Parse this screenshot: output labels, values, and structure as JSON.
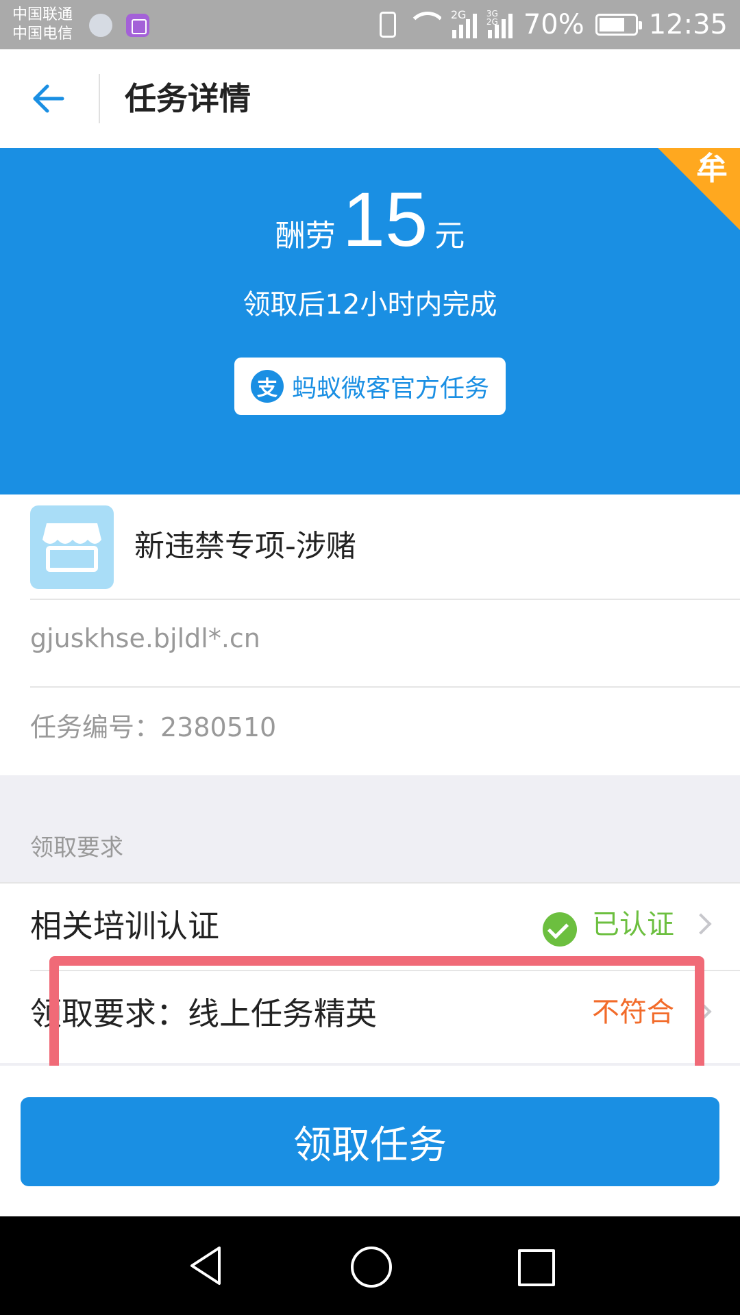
{
  "status_bar": {
    "carrier_1": "中国联通",
    "carrier_2": "中国电信",
    "signal_1_label": "2G",
    "signal_2_label": "3G 2G",
    "battery_percent": "70%",
    "battery_level": 0.7,
    "time": "12:35"
  },
  "nav": {
    "title": "任务详情"
  },
  "banner": {
    "reward_label": "酬劳",
    "reward_amount": "15",
    "reward_unit": "元",
    "deadline": "领取后12小时内完成",
    "official_tag": "蚂蚁微客官方任务",
    "alipay_glyph": "支",
    "corner_badge": "牟",
    "colors": {
      "primary": "#1a8fe3",
      "corner": "#ffa81f"
    }
  },
  "task": {
    "name": "新违禁专项-涉赌",
    "url": "gjuskhse.bjldl*.cn",
    "number": "任务编号：2380510"
  },
  "requirements": {
    "section_label": "领取要求",
    "items": [
      {
        "title": "相关培训认证",
        "status": "已认证"
      },
      {
        "title": "领取要求：线上任务精英",
        "status": "不符合"
      }
    ],
    "colors": {
      "ok": "#6cbf3f",
      "fail": "#f26b2a",
      "highlight": "#f06a77"
    }
  },
  "actions": {
    "claim_label": "领取任务"
  }
}
